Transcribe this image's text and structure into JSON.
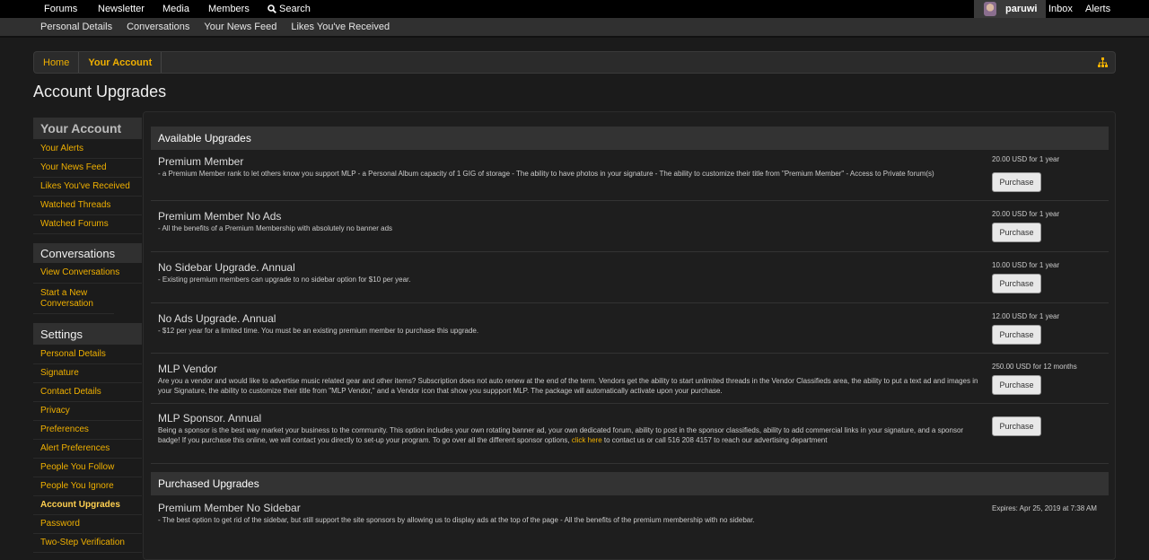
{
  "topnav": {
    "forums": "Forums",
    "newsletter": "Newsletter",
    "media": "Media",
    "members": "Members",
    "search": "Search"
  },
  "user": {
    "name": "paruwi",
    "inbox": "Inbox",
    "alerts": "Alerts"
  },
  "subnav": [
    "Personal Details",
    "Conversations",
    "Your News Feed",
    "Likes You've Received"
  ],
  "breadcrumb": {
    "home": "Home",
    "current": "Your Account"
  },
  "page_title": "Account Upgrades",
  "sidebar": {
    "account_heading": "Your Account",
    "account_items": [
      "Your Alerts",
      "Your News Feed",
      "Likes You've Received",
      "Watched Threads",
      "Watched Forums"
    ],
    "conversations_heading": "Conversations",
    "conversations_items": [
      "View Conversations",
      "Start a New Conversation"
    ],
    "settings_heading": "Settings",
    "settings_items": [
      "Personal Details",
      "Signature",
      "Contact Details",
      "Privacy",
      "Preferences",
      "Alert Preferences",
      "People You Follow",
      "People You Ignore",
      "Account Upgrades",
      "Password",
      "Two-Step Verification"
    ]
  },
  "available": {
    "heading": "Available Upgrades",
    "purchase_label": "Purchase",
    "items": [
      {
        "title": "Premium Member",
        "desc": "- a Premium Member rank to let others know you support MLP - a Personal Album capacity of 1 GIG of storage - The ability to have photos in your signature - The ability to customize their title from \"Premium Member\" - Access to Private forum(s)",
        "price": "20.00 USD for 1 year"
      },
      {
        "title": "Premium Member No Ads",
        "desc": "- All the benefits of a Premium Membership with absolutely no banner ads",
        "price": "20.00 USD for 1 year"
      },
      {
        "title": "No Sidebar Upgrade. Annual",
        "desc": "- Existing premium members can upgrade to no sidebar option for $10 per year.",
        "price": "10.00 USD for 1 year"
      },
      {
        "title": "No Ads Upgrade. Annual",
        "desc": "- $12 per year for a limited time. You must be an existing premium member to purchase this upgrade.",
        "price": "12.00 USD for 1 year"
      },
      {
        "title": "MLP Vendor",
        "desc": "Are you a vendor and would like to advertise music related gear and other items? Subscription does not auto renew at the end of the term. Vendors get the ability to start unlimited threads in the Vendor Classifieds area, the ability to put a text ad and images in your Signature, the ability to customize their title from \"MLP Vendor,\" and a Vendor icon that show you suppport MLP. The package will automatically activate upon your purchase.",
        "price": "250.00 USD for 12 months"
      },
      {
        "title": "MLP Sponsor. Annual",
        "desc_a": "Being a sponsor is the best way market your business to the community. This option includes your own rotating banner ad, your own dedicated forum, ability to post in the sponsor classifieds, ability to add commercial links in your signature, and a sponsor badge! If you purchase this online, we will contact you directly to set-up your program. To go over all the different sponsor options, ",
        "link": "click here",
        "desc_b": " to contact us or call 516 208 4157 to reach our advertising department",
        "price": ""
      }
    ]
  },
  "purchased": {
    "heading": "Purchased Upgrades",
    "items": [
      {
        "title": "Premium Member No Sidebar",
        "desc": "- The best option to get rid of the sidebar, but still support the site sponsors by allowing us to display ads at the top of the page - All the benefits of the premium membership with no sidebar.",
        "expires": "Expires: Apr 25, 2019 at 7:38 AM"
      }
    ]
  }
}
